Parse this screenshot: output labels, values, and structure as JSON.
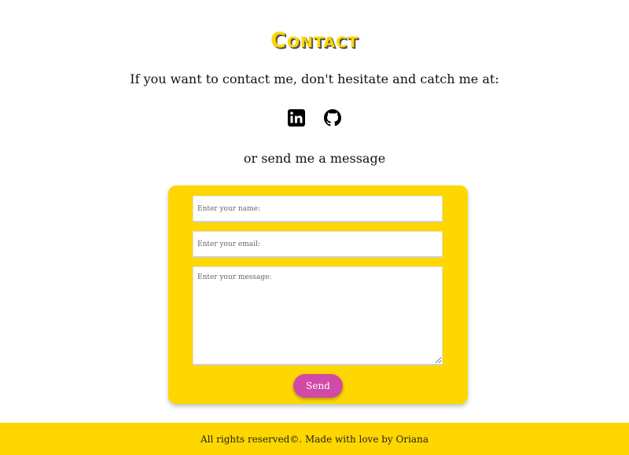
{
  "colors": {
    "accent": "#ffd700",
    "button": "#d04aa8",
    "text": "#111111"
  },
  "header": {
    "title": "Contact",
    "intro": "If you want to contact me, don't hesitate and catch me at:"
  },
  "socials": [
    {
      "name": "linkedin",
      "icon": "linkedin-icon"
    },
    {
      "name": "github",
      "icon": "github-icon"
    }
  ],
  "form": {
    "lead": "or send me a message",
    "name_placeholder": "Enter your name:",
    "email_placeholder": "Enter your email:",
    "message_placeholder": "Enter your message:",
    "send_label": "Send"
  },
  "footer": {
    "text": "All rights reserved©. Made with love by Oriana"
  }
}
